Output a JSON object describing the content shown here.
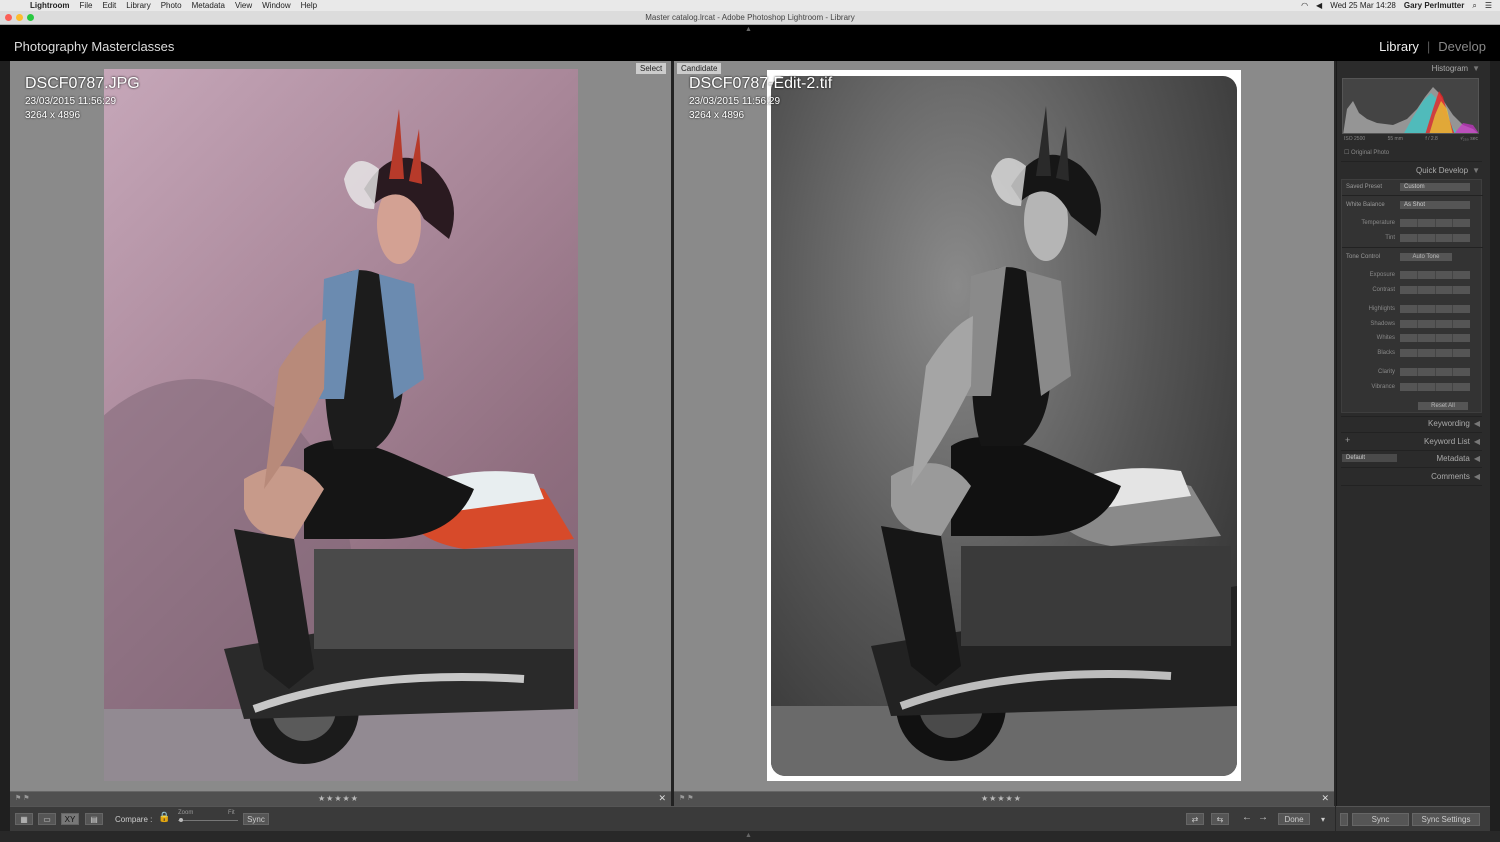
{
  "menubar": {
    "app": "Lightroom",
    "items": [
      "File",
      "Edit",
      "Library",
      "Photo",
      "Metadata",
      "View",
      "Window",
      "Help"
    ],
    "datetime": "Wed 25 Mar  14:28",
    "user": "Gary Perlmutter"
  },
  "window": {
    "title": "Master catalog.lrcat - Adobe Photoshop Lightroom - Library"
  },
  "identity": {
    "name": "Photography Masterclasses"
  },
  "modules": {
    "library": "Library",
    "separator": "|",
    "develop": "Develop"
  },
  "select_view": {
    "tag": "Select",
    "filename": "DSCF0787.JPG",
    "datetime": "23/03/2015 11:56:29",
    "dimensions": "3264 x 4896",
    "stars": "★★★★★"
  },
  "candidate_view": {
    "tag": "Candidate",
    "filename": "DSCF0787-Edit-2.tif",
    "datetime": "23/03/2015 11:56:29",
    "dimensions": "3264 x 4896",
    "stars": "★★★★★"
  },
  "toolbar": {
    "compare_label": "Compare :",
    "zoom_label": "Zoom",
    "fit_label": "Fit",
    "sync_label": "Sync",
    "done_label": "Done"
  },
  "right_panel": {
    "histogram_label": "Histogram",
    "histogram_meta": {
      "iso": "ISO 2500",
      "focal": "55 mm",
      "aperture": "f / 2.8",
      "shutter": "¹⁄₂₅₀ sec"
    },
    "original_photo": "Original Photo",
    "quick_develop": "Quick Develop",
    "saved_preset_label": "Saved Preset",
    "saved_preset_value": "Custom",
    "white_balance_label": "White Balance",
    "white_balance_value": "As Shot",
    "temperature": "Temperature",
    "tint": "Tint",
    "tone_control": "Tone Control",
    "auto_tone": "Auto Tone",
    "exposure": "Exposure",
    "contrast": "Contrast",
    "highlights": "Highlights",
    "shadows": "Shadows",
    "whites": "Whites",
    "blacks": "Blacks",
    "clarity": "Clarity",
    "vibrance": "Vibrance",
    "reset_all": "Reset All",
    "keywording": "Keywording",
    "keyword_list": "Keyword List",
    "metadata": "Metadata",
    "metadata_preset": "Default",
    "comments": "Comments",
    "sync": "Sync",
    "sync_settings": "Sync Settings"
  },
  "colors": {
    "accent_active": "#eeeeee",
    "panel_bg": "#2b2b2b",
    "view_bg": "#8a8a8a"
  }
}
